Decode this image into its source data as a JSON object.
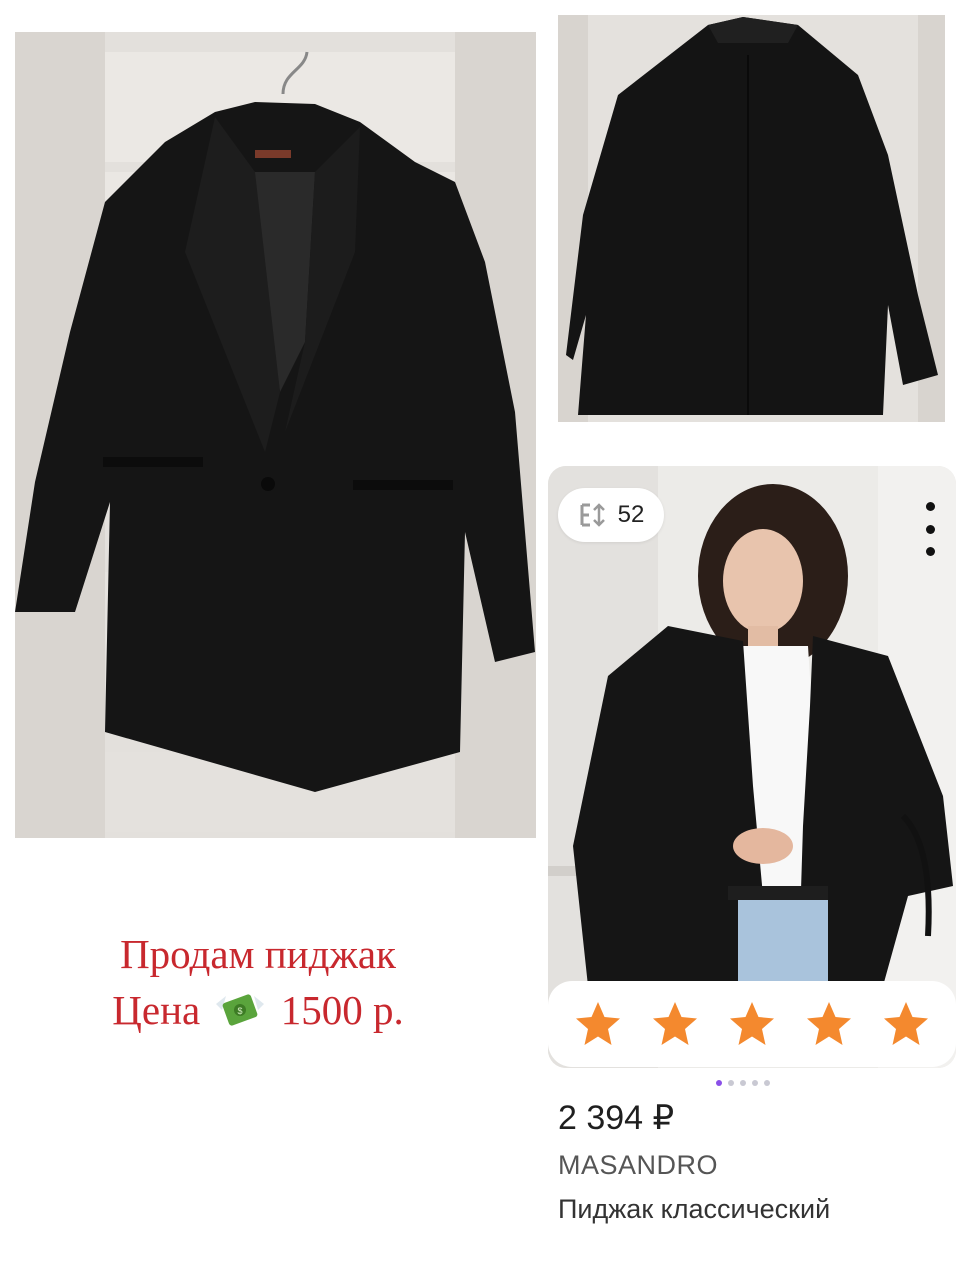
{
  "sale": {
    "title": "Продам пиджак",
    "price_label": "Цена",
    "price_value": "1500 р."
  },
  "product_card": {
    "size_value": "52",
    "rating_stars": 5,
    "rating_max": 5,
    "carousel_pages": 5,
    "carousel_active": 1,
    "price": "2 394 ₽",
    "brand": "MASANDRO",
    "name": "Пиджак классический"
  },
  "icons": [
    "size-icon",
    "more-vert-icon",
    "star-icon",
    "money-with-wings-icon"
  ],
  "colors": {
    "sale_text": "#c8282e",
    "star": "#f4892e",
    "pager_active": "#8a4fe8",
    "jacket": "#151515"
  }
}
